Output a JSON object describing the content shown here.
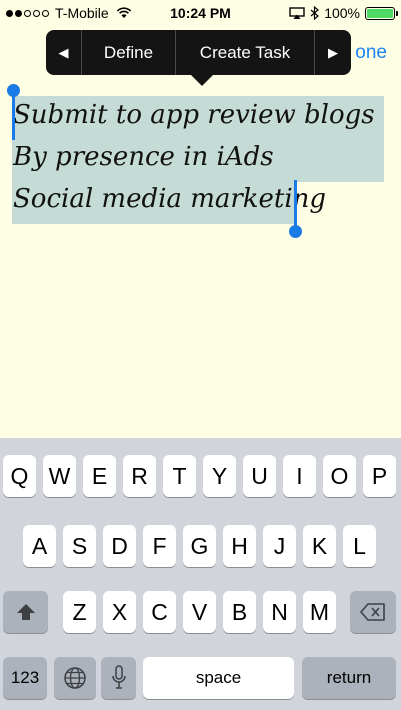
{
  "status_bar": {
    "carrier": "T-Mobile",
    "time": "10:24 PM",
    "battery": "100%",
    "signal_bars_filled": 2,
    "battery_level": 1.0
  },
  "nav": {
    "done_label": "one"
  },
  "edit_menu": {
    "prev_label": "◀",
    "define_label": "Define",
    "create_task_label": "Create Task",
    "next_label": "▶"
  },
  "note": {
    "lines": [
      "Submit to app review blogs",
      "By presence in iAds",
      "Social media marketing"
    ]
  },
  "keyboard": {
    "row1": [
      "Q",
      "W",
      "E",
      "R",
      "T",
      "Y",
      "U",
      "I",
      "O",
      "P"
    ],
    "row2": [
      "A",
      "S",
      "D",
      "F",
      "G",
      "H",
      "J",
      "K",
      "L"
    ],
    "row3": [
      "Z",
      "X",
      "C",
      "V",
      "B",
      "N",
      "M"
    ],
    "numbers_label": "123",
    "space_label": "space",
    "return_label": "return"
  },
  "colors": {
    "accent": "#1a85f7",
    "selection": "#c5dbd6",
    "paper": "#fefee4",
    "battery": "#4cd964"
  }
}
